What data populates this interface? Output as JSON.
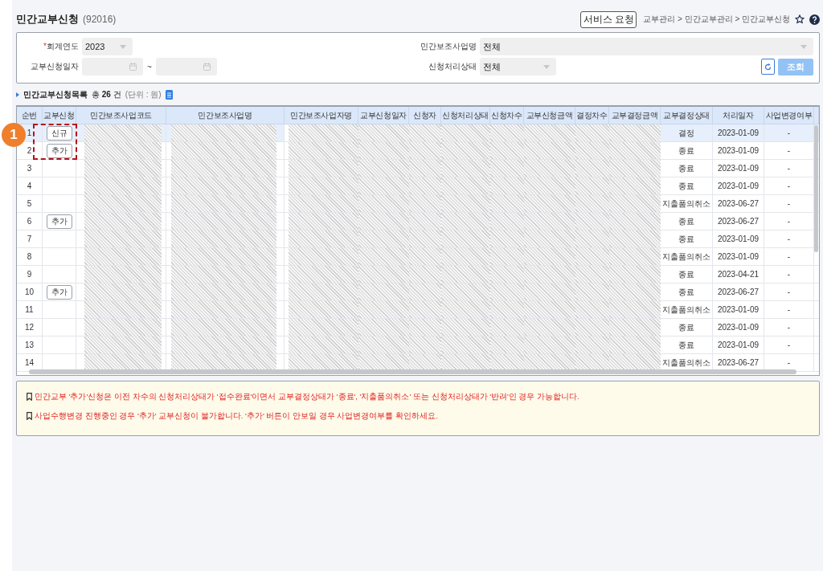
{
  "header": {
    "title": "민간교부신청",
    "code": "(92016)",
    "service_button": "서비스 요청",
    "breadcrumb": "교부관리 > 민간교부관리 > 민간교부신청"
  },
  "filters": {
    "fiscal_year": {
      "required_mark": "*",
      "label": "회계연도",
      "value": "2023"
    },
    "project_name": {
      "label": "민간보조사업명",
      "value": "전체"
    },
    "request_date": {
      "label": "교부신청일자",
      "separator": "~"
    },
    "process_status": {
      "label": "신청처리상태",
      "value": "전체"
    },
    "search_button": "조회"
  },
  "list": {
    "title": "민간교부신청목록",
    "count": "총 **26** 건",
    "unit": "(단위 : 원)"
  },
  "table": {
    "columns": [
      "순번",
      "교부신청",
      "민간보조사업코드",
      "민간보조사업명",
      "민간보조사업자명",
      "교부신청일자",
      "신청자",
      "신청처리상태",
      "신청차수",
      "교부신청금액",
      "결정차수",
      "교부결정금액",
      "교부결정상태",
      "처리일자",
      "사업변경여부"
    ],
    "rows": [
      {
        "no": "1",
        "action": "신규",
        "status": "결정",
        "date": "2023-01-09",
        "changed": "-",
        "selected": true
      },
      {
        "no": "2",
        "action": "추가",
        "status": "종료",
        "date": "2023-01-09",
        "changed": "-",
        "selected": false
      },
      {
        "no": "3",
        "status": "종료",
        "date": "2023-01-09",
        "changed": "-",
        "selected": false
      },
      {
        "no": "4",
        "status": "종료",
        "date": "2023-01-09",
        "changed": "-",
        "selected": false
      },
      {
        "no": "5",
        "status": "지출품의취소",
        "date": "2023-06-27",
        "changed": "-",
        "selected": false
      },
      {
        "no": "6",
        "action": "추가",
        "status": "종료",
        "date": "2023-06-27",
        "changed": "-",
        "selected": false
      },
      {
        "no": "7",
        "status": "종료",
        "date": "2023-01-09",
        "changed": "-",
        "selected": false
      },
      {
        "no": "8",
        "status": "지출품의취소",
        "date": "2023-01-09",
        "changed": "-",
        "selected": false
      },
      {
        "no": "9",
        "status": "종료",
        "date": "2023-04-21",
        "changed": "-",
        "selected": false
      },
      {
        "no": "10",
        "action": "추가",
        "status": "종료",
        "date": "2023-06-27",
        "changed": "-",
        "selected": false
      },
      {
        "no": "11",
        "status": "지출품의취소",
        "date": "2023-01-09",
        "changed": "-",
        "selected": false
      },
      {
        "no": "12",
        "status": "종료",
        "date": "2023-01-09",
        "changed": "-",
        "selected": false
      },
      {
        "no": "13",
        "status": "종료",
        "date": "2023-01-09",
        "changed": "-",
        "selected": false
      },
      {
        "no": "14",
        "status": "지출품의취소",
        "date": "2023-06-27",
        "changed": "-",
        "selected": false
      }
    ]
  },
  "annotation": {
    "number": "1"
  },
  "notices": [
    "민간교부 '추가'신청은 이전 차수의 신청처리상태가 '접수완료'이면서 교부결정상태가 '종료', '지출품의취소' 또는 신청처리상태가 '반려'인 경우 가능합니다.",
    "사업수행변경 진행중인 경우 '추가' 교부신청이 불가합니다. '추가' 버튼이 안보일 경우 사업변경여부를 확인하세요."
  ]
}
